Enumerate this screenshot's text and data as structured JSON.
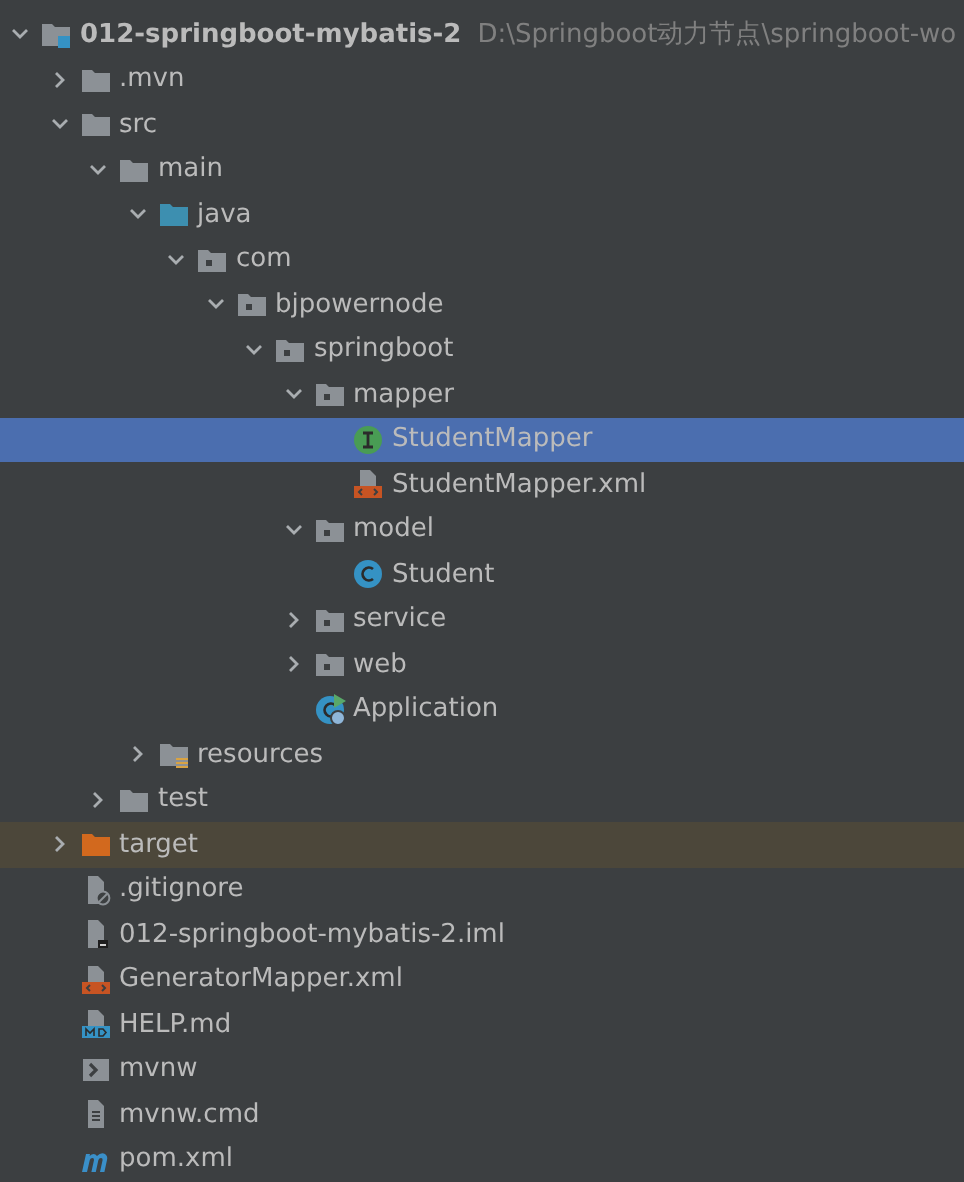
{
  "project": {
    "kind": "module",
    "name": "012-springboot-mybatis-2",
    "path": "D:\\Springboot动力节点\\springboot-wo",
    "expanded": true,
    "selected": false,
    "children": [
      {
        "kind": "folder",
        "name": ".mvn",
        "expanded": false,
        "selected": false
      },
      {
        "kind": "folder",
        "name": "src",
        "expanded": true,
        "selected": false,
        "children": [
          {
            "kind": "folder",
            "name": "main",
            "expanded": true,
            "selected": false,
            "children": [
              {
                "kind": "source-folder",
                "name": "java",
                "expanded": true,
                "selected": false,
                "children": [
                  {
                    "kind": "package",
                    "name": "com",
                    "expanded": true,
                    "selected": false,
                    "children": [
                      {
                        "kind": "package",
                        "name": "bjpowernode",
                        "expanded": true,
                        "selected": false,
                        "children": [
                          {
                            "kind": "package",
                            "name": "springboot",
                            "expanded": true,
                            "selected": false,
                            "children": [
                              {
                                "kind": "package",
                                "name": "mapper",
                                "expanded": true,
                                "selected": false,
                                "children": [
                                  {
                                    "kind": "interface",
                                    "name": "StudentMapper",
                                    "selected": true
                                  },
                                  {
                                    "kind": "xml-file",
                                    "name": "StudentMapper.xml",
                                    "selected": false
                                  }
                                ]
                              },
                              {
                                "kind": "package",
                                "name": "model",
                                "expanded": true,
                                "selected": false,
                                "children": [
                                  {
                                    "kind": "class",
                                    "name": "Student",
                                    "selected": false
                                  }
                                ]
                              },
                              {
                                "kind": "package",
                                "name": "service",
                                "expanded": false,
                                "selected": false
                              },
                              {
                                "kind": "package",
                                "name": "web",
                                "expanded": false,
                                "selected": false
                              },
                              {
                                "kind": "app-class",
                                "name": "Application",
                                "selected": false
                              }
                            ]
                          }
                        ]
                      }
                    ]
                  }
                ]
              },
              {
                "kind": "resources-folder",
                "name": "resources",
                "expanded": false,
                "selected": false
              }
            ]
          },
          {
            "kind": "folder",
            "name": "test",
            "expanded": false,
            "selected": false
          }
        ]
      },
      {
        "kind": "excluded-folder",
        "name": "target",
        "expanded": false,
        "selected": false
      },
      {
        "kind": "ignore-file",
        "name": ".gitignore",
        "selected": false
      },
      {
        "kind": "iml-file",
        "name": "012-springboot-mybatis-2.iml",
        "selected": false
      },
      {
        "kind": "xml-file",
        "name": "GeneratorMapper.xml",
        "selected": false
      },
      {
        "kind": "markdown-file",
        "name": "HELP.md",
        "selected": false
      },
      {
        "kind": "shell-script",
        "name": "mvnw",
        "selected": false
      },
      {
        "kind": "text-file",
        "name": "mvnw.cmd",
        "selected": false
      },
      {
        "kind": "maven-file",
        "name": "pom.xml",
        "selected": false
      }
    ]
  }
}
